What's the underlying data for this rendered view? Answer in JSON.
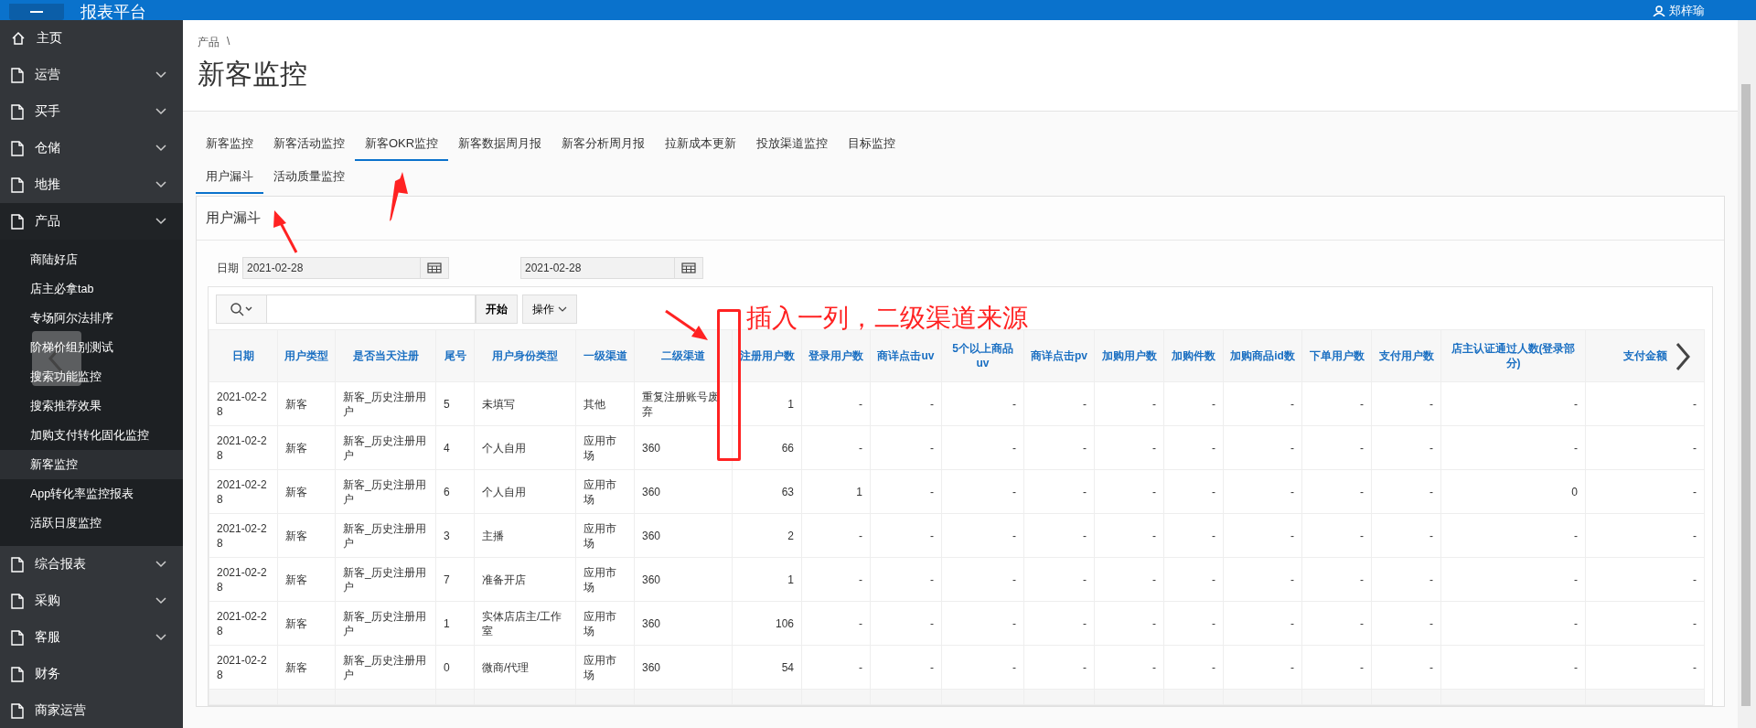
{
  "header": {
    "app_title": "报表平台",
    "user": "郑梓瑜"
  },
  "sidebar": {
    "items": [
      {
        "label": "主页",
        "kind": "home",
        "expanded": false,
        "has_children": false
      },
      {
        "label": "运营",
        "kind": "page",
        "expanded": false,
        "has_children": true
      },
      {
        "label": "买手",
        "kind": "page",
        "expanded": false,
        "has_children": true
      },
      {
        "label": "仓储",
        "kind": "page",
        "expanded": false,
        "has_children": true
      },
      {
        "label": "地推",
        "kind": "page",
        "expanded": false,
        "has_children": true
      },
      {
        "label": "产品",
        "kind": "page",
        "expanded": true,
        "has_children": true,
        "children": [
          {
            "label": "商陆好店",
            "selected": false
          },
          {
            "label": "店主必拿tab",
            "selected": false
          },
          {
            "label": "专场阿尔法排序",
            "selected": false
          },
          {
            "label": "阶梯价组别测试",
            "selected": false
          },
          {
            "label": "搜索功能监控",
            "selected": false
          },
          {
            "label": "搜索推荐效果",
            "selected": false
          },
          {
            "label": "加购支付转化固化监控",
            "selected": false
          },
          {
            "label": "新客监控",
            "selected": true
          },
          {
            "label": "App转化率监控报表",
            "selected": false
          },
          {
            "label": "活跃日度监控",
            "selected": false
          }
        ]
      },
      {
        "label": "综合报表",
        "kind": "page",
        "expanded": false,
        "has_children": true
      },
      {
        "label": "采购",
        "kind": "page",
        "expanded": false,
        "has_children": true
      },
      {
        "label": "客服",
        "kind": "page",
        "expanded": false,
        "has_children": true
      },
      {
        "label": "财务",
        "kind": "page",
        "expanded": false,
        "has_children": false
      },
      {
        "label": "商家运营",
        "kind": "page",
        "expanded": false,
        "has_children": false
      }
    ]
  },
  "breadcrumb": {
    "items": [
      "产品"
    ],
    "separator": "\\"
  },
  "page_title": "新客监控",
  "tabs": [
    [
      {
        "label": "新客监控",
        "selected": false
      },
      {
        "label": "新客活动监控",
        "selected": false
      },
      {
        "label": "新客OKR监控",
        "selected": true
      },
      {
        "label": "新客数据周月报",
        "selected": false
      },
      {
        "label": "新客分析周月报",
        "selected": false
      },
      {
        "label": "拉新成本更新",
        "selected": false
      },
      {
        "label": "投放渠道监控",
        "selected": false
      },
      {
        "label": "目标监控",
        "selected": false
      }
    ],
    [
      {
        "label": "用户漏斗",
        "selected": true
      },
      {
        "label": "活动质量监控",
        "selected": false
      }
    ]
  ],
  "panel": {
    "title": "用户漏斗",
    "date_label": "日期",
    "date_from": "2021-02-28",
    "date_to": "2021-02-28",
    "toolbar": {
      "go_button": "开始",
      "actions_button": "操作"
    },
    "table": {
      "columns": [
        "日期",
        "用户类型",
        "是否当天注册",
        "尾号",
        "用户身份类型",
        "一级渠道",
        "二级渠道",
        "注册用户数",
        "登录用户数",
        "商详点击uv",
        "5个以上商品uv",
        "商详点击pv",
        "加购用户数",
        "加购件数",
        "加购商品id数",
        "下单用户数",
        "支付用户数",
        "店主认证通过人数(登录部分)",
        "支付金额"
      ],
      "rows": [
        [
          "2021-02-28",
          "新客",
          "新客_历史注册用户",
          "5",
          "未填写",
          "其他",
          "重复注册账号废弃",
          "1",
          "-",
          "-",
          "-",
          "-",
          "-",
          "-",
          "-",
          "-",
          "-",
          "-",
          "-"
        ],
        [
          "2021-02-28",
          "新客",
          "新客_历史注册用户",
          "4",
          "个人自用",
          "应用市场",
          "360",
          "66",
          "-",
          "-",
          "-",
          "-",
          "-",
          "-",
          "-",
          "-",
          "-",
          "-",
          "-"
        ],
        [
          "2021-02-28",
          "新客",
          "新客_历史注册用户",
          "6",
          "个人自用",
          "应用市场",
          "360",
          "63",
          "1",
          "-",
          "-",
          "-",
          "-",
          "-",
          "-",
          "-",
          "-",
          "0",
          "-"
        ],
        [
          "2021-02-28",
          "新客",
          "新客_历史注册用户",
          "3",
          "主播",
          "应用市场",
          "360",
          "2",
          "-",
          "-",
          "-",
          "-",
          "-",
          "-",
          "-",
          "-",
          "-",
          "-",
          "-"
        ],
        [
          "2021-02-28",
          "新客",
          "新客_历史注册用户",
          "7",
          "准备开店",
          "应用市场",
          "360",
          "1",
          "-",
          "-",
          "-",
          "-",
          "-",
          "-",
          "-",
          "-",
          "-",
          "-",
          "-"
        ],
        [
          "2021-02-28",
          "新客",
          "新客_历史注册用户",
          "1",
          "实体店店主/工作室",
          "应用市场",
          "360",
          "106",
          "-",
          "-",
          "-",
          "-",
          "-",
          "-",
          "-",
          "-",
          "-",
          "-",
          "-"
        ],
        [
          "2021-02-28",
          "新客",
          "新客_历史注册用户",
          "0",
          "微商/代理",
          "应用市场",
          "360",
          "54",
          "-",
          "-",
          "-",
          "-",
          "-",
          "-",
          "-",
          "-",
          "-",
          "-",
          "-"
        ]
      ]
    }
  },
  "annotation": {
    "text": "插入一列，二级渠道来源"
  }
}
